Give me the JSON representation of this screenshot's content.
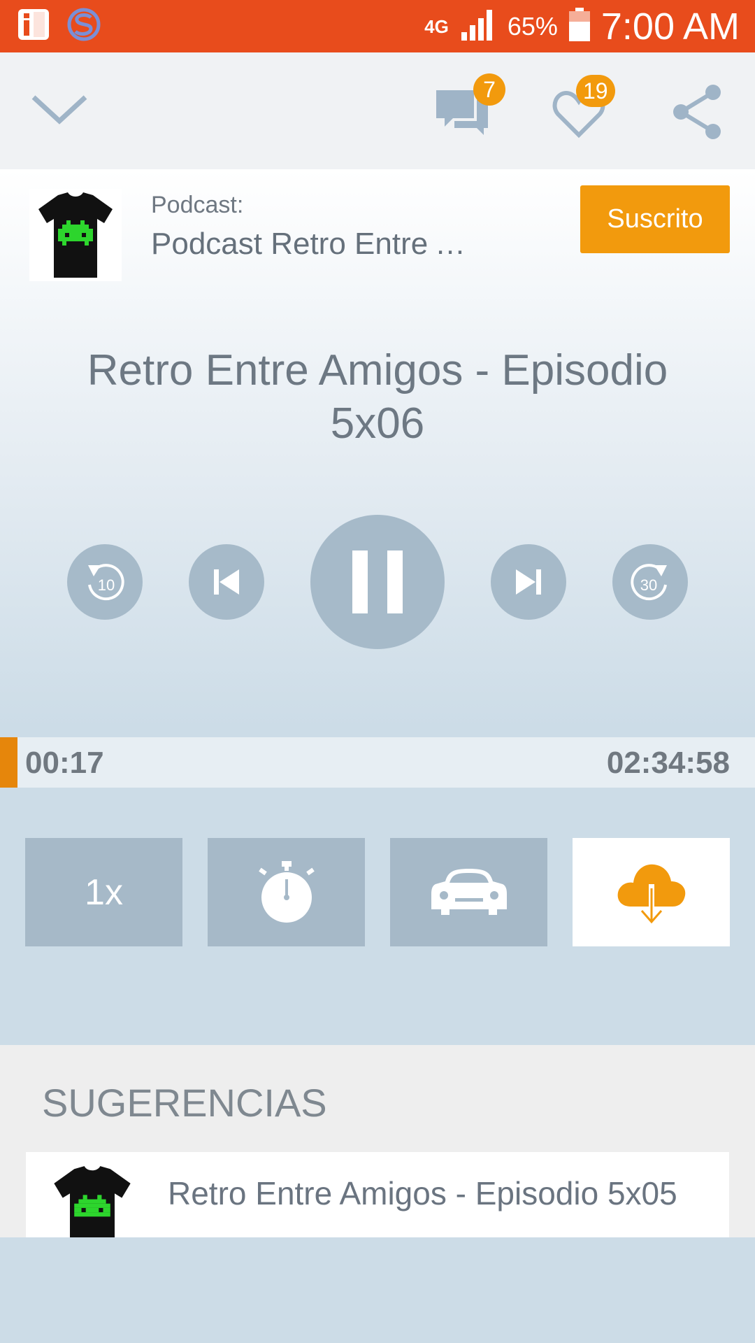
{
  "status_bar": {
    "network": "4G",
    "battery_percent": "65%",
    "time": "7:00 AM",
    "notif_icons": [
      "info-icon",
      "app-s-icon"
    ]
  },
  "top_bar": {
    "comments_count": "7",
    "likes_count": "19"
  },
  "podcast": {
    "label": "Podcast:",
    "name": "Podcast Retro Entre Amigos",
    "subscribe_label": "Suscrito"
  },
  "episode": {
    "title": "Retro Entre Amigos - Episodio 5x06"
  },
  "controls": {
    "rewind_seconds": "10",
    "forward_seconds": "30"
  },
  "progress": {
    "current": "00:17",
    "total": "02:34:58",
    "fraction": 0.0018
  },
  "options": {
    "speed_label": "1x"
  },
  "suggestions": {
    "title": "SUGERENCIAS",
    "items": [
      {
        "title": "Retro Entre Amigos - Episodio 5x05"
      }
    ]
  },
  "colors": {
    "status_bar": "#e84c1c",
    "accent": "#f29a0d",
    "control_bg": "#a6bac9"
  }
}
